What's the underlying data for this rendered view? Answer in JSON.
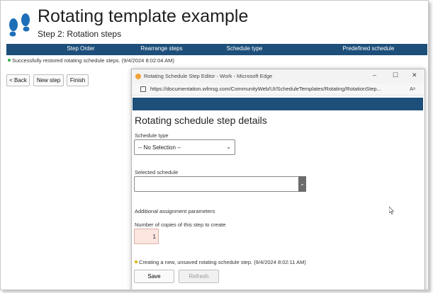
{
  "page": {
    "title": "Rotating template example",
    "subtitle": "Step 2: Rotation steps"
  },
  "steps": [
    "Step Order",
    "Rearrange steps",
    "Schedule type",
    "Predefined schedule"
  ],
  "status_message": "Successfully restored rotating schedule steps. (9/4/2024 8:02:04 AM)",
  "toolbar": {
    "back_label": "< Back",
    "new_step_label": "New step",
    "finish_label": "Finish"
  },
  "popup": {
    "window_title": "Rotating Schedule Step Editor - Work - Microsoft Edge",
    "url": "https://documentation.wfmsg.com/CommunityWeb/UI/ScheduleTemplates/Rotating/RotationStep...",
    "heading": "Rotating schedule step details",
    "schedule_type_label": "Schedule type",
    "schedule_type_value": "-- No Selection --",
    "selected_schedule_label": "Selected schedule",
    "selected_schedule_value": "",
    "additional_params_label": "Additional assignment parameters",
    "copies_label": "Number of copies of this step to create",
    "copies_value": "1",
    "status": "Creating a new, unsaved rotating schedule step. (9/4/2024 8:02:11 AM)",
    "save_label": "Save",
    "refresh_label": "Refresh"
  },
  "colors": {
    "bar": "#1d4f7a",
    "logo": "#1d6fb8",
    "success_dot": "#2db34a",
    "warning_dot": "#e0b000"
  },
  "icons": [
    "footprints-logo-icon",
    "edge-icon",
    "minimize-icon",
    "maximize-icon",
    "close-icon",
    "lock-icon",
    "reader-mode-icon",
    "chevron-down-icon",
    "mouse-cursor-icon"
  ]
}
